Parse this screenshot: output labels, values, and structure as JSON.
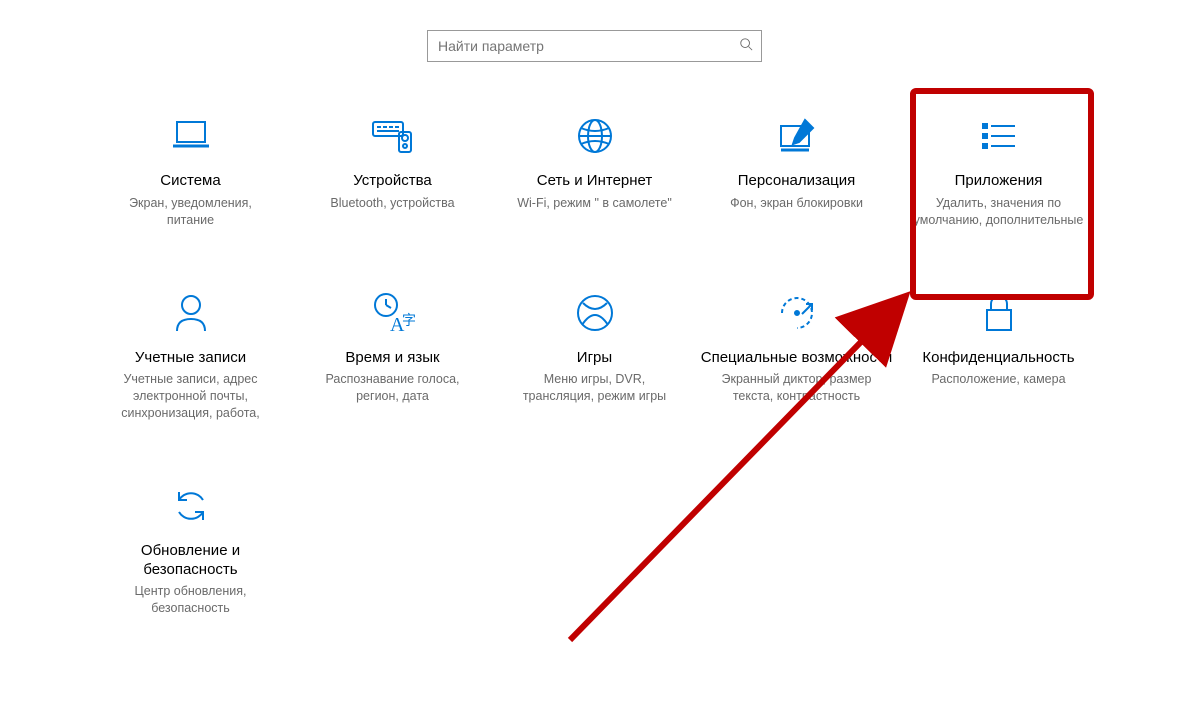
{
  "search": {
    "placeholder": "Найти параметр"
  },
  "tiles": [
    {
      "title": "Система",
      "desc": "Экран, уведомления, питание"
    },
    {
      "title": "Устройства",
      "desc": "Bluetooth, устройства"
    },
    {
      "title": "Сеть и Интернет",
      "desc": "Wi-Fi, режим \" в самолете\""
    },
    {
      "title": "Персонализация",
      "desc": "Фон, экран блокировки"
    },
    {
      "title": "Приложения",
      "desc": "Удалить, значения по умолчанию, дополнительные"
    },
    {
      "title": "Учетные записи",
      "desc": "Учетные записи, адрес электронной почты, синхронизация, работа,"
    },
    {
      "title": "Время и язык",
      "desc": "Распознавание голоса, регион, дата"
    },
    {
      "title": "Игры",
      "desc": "Меню игры, DVR, трансляция, режим игры"
    },
    {
      "title": "Специальные возможности",
      "desc": "Экранный диктор, размер текста, контрастность"
    },
    {
      "title": "Конфиденциальность",
      "desc": "Расположение, камера"
    },
    {
      "title": "Обновление и безопасность",
      "desc": "Центр обновления, безопасность"
    }
  ],
  "accent": "#0078D7",
  "highlight": "#c00000"
}
